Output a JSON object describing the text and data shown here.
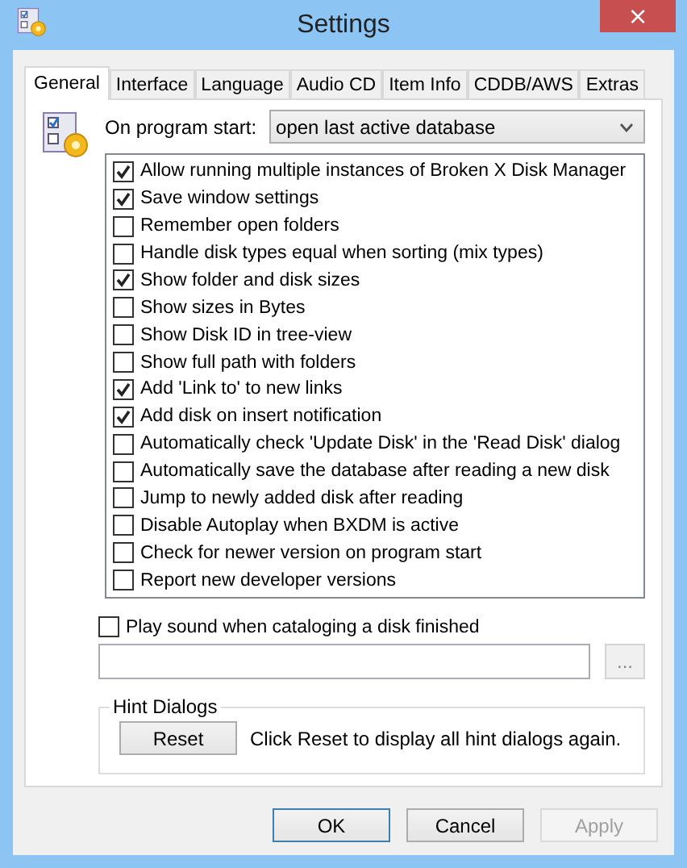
{
  "window": {
    "title": "Settings",
    "close_label": "×"
  },
  "tabs": [
    {
      "label": "General",
      "selected": true
    },
    {
      "label": "Interface",
      "selected": false
    },
    {
      "label": "Language",
      "selected": false
    },
    {
      "label": "Audio CD",
      "selected": false
    },
    {
      "label": "Item Info",
      "selected": false
    },
    {
      "label": "CDDB/AWS",
      "selected": false
    },
    {
      "label": "Extras",
      "selected": false
    }
  ],
  "program_start": {
    "label": "On program start:",
    "value": "open last active database"
  },
  "options": [
    {
      "label": "Allow running multiple instances of Broken X Disk Manager",
      "checked": true
    },
    {
      "label": "Save window settings",
      "checked": true
    },
    {
      "label": "Remember open folders",
      "checked": false
    },
    {
      "label": "Handle disk types equal when sorting (mix types)",
      "checked": false
    },
    {
      "label": "Show folder and disk sizes",
      "checked": true
    },
    {
      "label": "Show sizes in Bytes",
      "checked": false
    },
    {
      "label": "Show Disk ID in tree-view",
      "checked": false
    },
    {
      "label": "Show full path with folders",
      "checked": false
    },
    {
      "label": "Add 'Link to' to new links",
      "checked": true
    },
    {
      "label": "Add disk on insert notification",
      "checked": true
    },
    {
      "label": "Automatically check 'Update Disk' in the 'Read Disk' dialog",
      "checked": false
    },
    {
      "label": "Automatically save the database after reading a new disk",
      "checked": false
    },
    {
      "label": "Jump to newly added disk after reading",
      "checked": false
    },
    {
      "label": "Disable Autoplay when BXDM is active",
      "checked": false
    },
    {
      "label": "Check for newer version on program start",
      "checked": false
    },
    {
      "label": "Report new developer versions",
      "checked": false
    }
  ],
  "play_sound": {
    "label": "Play sound when cataloging a disk finished",
    "checked": false,
    "browse_label": "..."
  },
  "hint_dialogs": {
    "title": "Hint Dialogs",
    "button": "Reset",
    "text": "Click Reset to display all hint dialogs again."
  },
  "buttons": [
    {
      "label": "OK",
      "disabled": false,
      "default": true
    },
    {
      "label": "Cancel",
      "disabled": false,
      "default": false
    },
    {
      "label": "Apply",
      "disabled": true,
      "default": false
    }
  ]
}
